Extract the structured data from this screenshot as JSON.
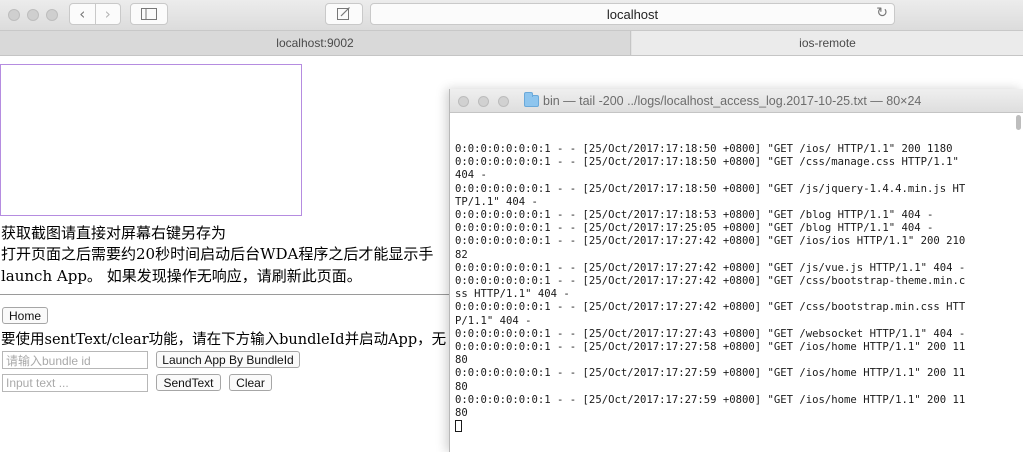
{
  "browser": {
    "url": "localhost",
    "tabs": [
      {
        "label": "localhost:9002"
      },
      {
        "label": "ios-remote"
      }
    ]
  },
  "page": {
    "instruction_line1": "获取截图请直接对屏幕右键另存为",
    "instruction_line2": "打开页面之后需要约20秒时间启动后台WDA程序之后才能显示手",
    "instruction_line3": "launch App。 如果发现操作无响应，请刷新此页面。",
    "home_button": "Home",
    "info_text": "要使用sentText/clear功能，请在下方输入bundleId并启动App，无",
    "bundle_placeholder": "请输入bundle id",
    "launch_button": "Launch App By BundleId",
    "text_placeholder": "Input text ...",
    "send_button": "SendText",
    "clear_button": "Clear"
  },
  "terminal": {
    "title": "bin — tail -200 ../logs/localhost_access_log.2017-10-25.txt — 80×24",
    "lines": [
      "0:0:0:0:0:0:0:1 - - [25/Oct/2017:17:18:50 +0800] \"GET /ios/ HTTP/1.1\" 200 1180",
      "0:0:0:0:0:0:0:1 - - [25/Oct/2017:17:18:50 +0800] \"GET /css/manage.css HTTP/1.1\"",
      "404 -",
      "0:0:0:0:0:0:0:1 - - [25/Oct/2017:17:18:50 +0800] \"GET /js/jquery-1.4.4.min.js HT",
      "TP/1.1\" 404 -",
      "0:0:0:0:0:0:0:1 - - [25/Oct/2017:17:18:53 +0800] \"GET /blog HTTP/1.1\" 404 -",
      "0:0:0:0:0:0:0:1 - - [25/Oct/2017:17:25:05 +0800] \"GET /blog HTTP/1.1\" 404 -",
      "0:0:0:0:0:0:0:1 - - [25/Oct/2017:17:27:42 +0800] \"GET /ios/ios HTTP/1.1\" 200 210",
      "82",
      "0:0:0:0:0:0:0:1 - - [25/Oct/2017:17:27:42 +0800] \"GET /js/vue.js HTTP/1.1\" 404 -",
      "0:0:0:0:0:0:0:1 - - [25/Oct/2017:17:27:42 +0800] \"GET /css/bootstrap-theme.min.c",
      "ss HTTP/1.1\" 404 -",
      "0:0:0:0:0:0:0:1 - - [25/Oct/2017:17:27:42 +0800] \"GET /css/bootstrap.min.css HTT",
      "P/1.1\" 404 -",
      "0:0:0:0:0:0:0:1 - - [25/Oct/2017:17:27:43 +0800] \"GET /websocket HTTP/1.1\" 404 -",
      "0:0:0:0:0:0:0:1 - - [25/Oct/2017:17:27:58 +0800] \"GET /ios/home HTTP/1.1\" 200 11",
      "80",
      "0:0:0:0:0:0:0:1 - - [25/Oct/2017:17:27:59 +0800] \"GET /ios/home HTTP/1.1\" 200 11",
      "80",
      "0:0:0:0:0:0:0:1 - - [25/Oct/2017:17:27:59 +0800] \"GET /ios/home HTTP/1.1\" 200 11",
      "80"
    ]
  },
  "icons": {
    "back": "back-chevron-icon",
    "forward": "forward-chevron-icon",
    "sidebar": "sidebar-icon",
    "reader": "reader-edit-icon",
    "reload": "reload-icon",
    "folder": "folder-icon"
  },
  "colors": {
    "screen_box_border": "#b58ce0",
    "folder": "#8ec5ee"
  }
}
